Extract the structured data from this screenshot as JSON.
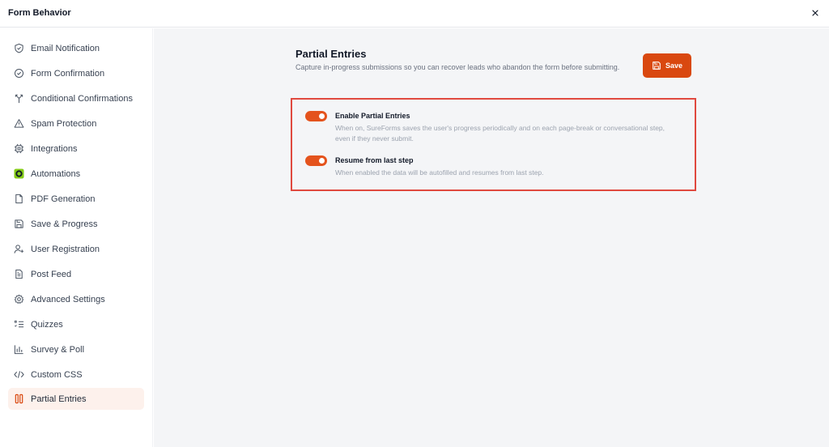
{
  "window": {
    "title": "Form Behavior"
  },
  "sidebar": {
    "items": [
      {
        "label": "Email Notification",
        "icon": "shield-check-icon"
      },
      {
        "label": "Form Confirmation",
        "icon": "circle-check-icon"
      },
      {
        "label": "Conditional Confirmations",
        "icon": "branch-icon"
      },
      {
        "label": "Spam Protection",
        "icon": "warning-triangle-icon"
      },
      {
        "label": "Integrations",
        "icon": "chip-icon"
      },
      {
        "label": "Automations",
        "icon": "automation-logo-icon"
      },
      {
        "label": "PDF Generation",
        "icon": "file-icon"
      },
      {
        "label": "Save & Progress",
        "icon": "floppy-icon"
      },
      {
        "label": "User Registration",
        "icon": "user-plus-icon"
      },
      {
        "label": "Post Feed",
        "icon": "document-icon"
      },
      {
        "label": "Advanced Settings",
        "icon": "gear-icon"
      },
      {
        "label": "Quizzes",
        "icon": "list-numbered-icon"
      },
      {
        "label": "Survey & Poll",
        "icon": "bar-chart-icon"
      },
      {
        "label": "Custom CSS",
        "icon": "code-icon"
      },
      {
        "label": "Partial Entries",
        "icon": "partial-entries-icon",
        "active": true
      }
    ]
  },
  "main": {
    "title": "Partial Entries",
    "description": "Capture in-progress submissions so you can recover leads who abandon the form before submitting.",
    "save_label": "Save",
    "settings": [
      {
        "label": "Enable Partial Entries",
        "description": "When on, SureForms saves the user's progress periodically and on each page-break or conversational step, even if they never submit.",
        "enabled": true
      },
      {
        "label": "Resume from last step",
        "description": "When enabled the data will be autofilled and resumes from last step.",
        "enabled": true
      }
    ]
  },
  "colors": {
    "accent": "#d9480f",
    "toggle_on": "#e4531d",
    "highlight_border": "#e0493f",
    "active_bg": "#fdf1ec"
  }
}
